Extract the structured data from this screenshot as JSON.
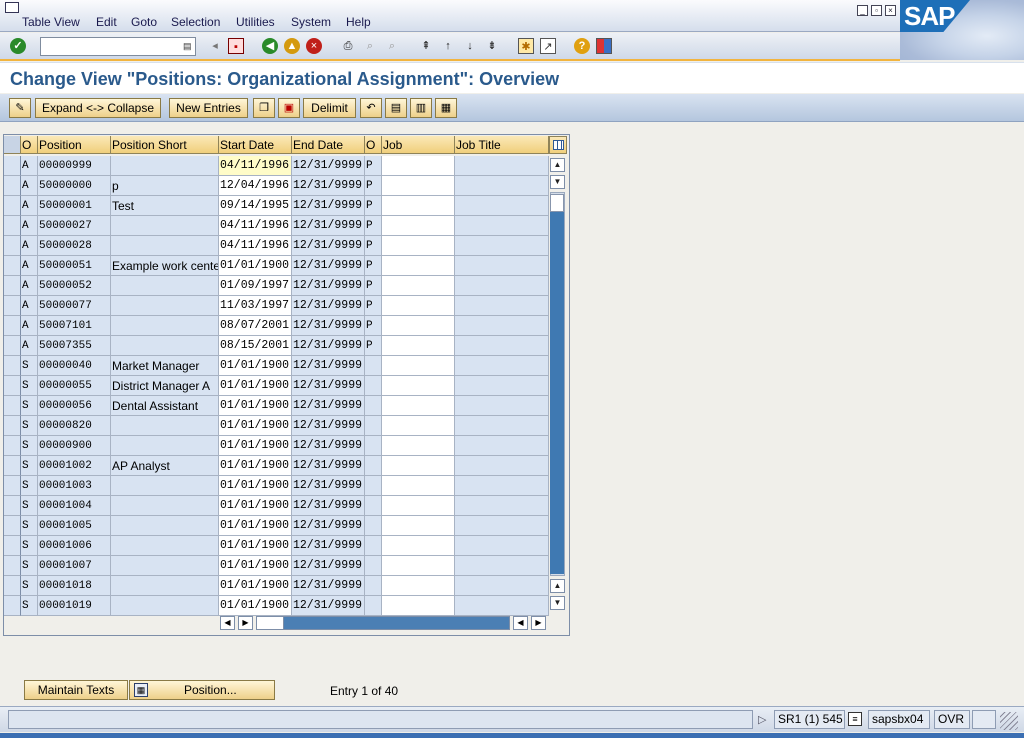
{
  "menubar": {
    "items": [
      "Table View",
      "Edit",
      "Goto",
      "Selection",
      "Utilities",
      "System",
      "Help"
    ],
    "logo": "SAP"
  },
  "toolbar": {
    "command_value": "",
    "icons": [
      "enter-icon",
      "save-icon",
      "back-icon",
      "exit-icon",
      "cancel-icon",
      "print-icon",
      "find-icon",
      "find-next-icon",
      "first-page-icon",
      "previous-page-icon",
      "next-page-icon",
      "last-page-icon",
      "create-session-icon",
      "shortcut-icon",
      "help-icon",
      "customize-layout-icon"
    ]
  },
  "title": "Change View \"Positions: Organizational Assignment\": Overview",
  "app_toolbar": {
    "expand_collapse": "Expand <-> Collapse",
    "new_entries": "New Entries",
    "delimit": "Delimit"
  },
  "table": {
    "headers": [
      "O",
      "Position",
      "Position Short",
      "Start Date",
      "End Date",
      "O",
      "Job",
      "Job Title"
    ],
    "rows": [
      [
        "A",
        "00000999",
        "",
        "04/11/1996",
        "12/31/9999",
        "P",
        "",
        ""
      ],
      [
        "A",
        "50000000",
        "p",
        "12/04/1996",
        "12/31/9999",
        "P",
        "",
        ""
      ],
      [
        "A",
        "50000001",
        "Test",
        "09/14/1995",
        "12/31/9999",
        "P",
        "",
        ""
      ],
      [
        "A",
        "50000027",
        "",
        "04/11/1996",
        "12/31/9999",
        "P",
        "",
        ""
      ],
      [
        "A",
        "50000028",
        "",
        "04/11/1996",
        "12/31/9999",
        "P",
        "",
        ""
      ],
      [
        "A",
        "50000051",
        "Example work cente",
        "01/01/1900",
        "12/31/9999",
        "P",
        "",
        ""
      ],
      [
        "A",
        "50000052",
        "",
        "01/09/1997",
        "12/31/9999",
        "P",
        "",
        ""
      ],
      [
        "A",
        "50000077",
        "",
        "11/03/1997",
        "12/31/9999",
        "P",
        "",
        ""
      ],
      [
        "A",
        "50007101",
        "",
        "08/07/2001",
        "12/31/9999",
        "P",
        "",
        ""
      ],
      [
        "A",
        "50007355",
        "",
        "08/15/2001",
        "12/31/9999",
        "P",
        "",
        ""
      ],
      [
        "S",
        "00000040",
        "Market Manager",
        "01/01/1900",
        "12/31/9999",
        "",
        "",
        ""
      ],
      [
        "S",
        "00000055",
        "District Manager A",
        "01/01/1900",
        "12/31/9999",
        "",
        "",
        ""
      ],
      [
        "S",
        "00000056",
        "Dental Assistant",
        "01/01/1900",
        "12/31/9999",
        "",
        "",
        ""
      ],
      [
        "S",
        "00000820",
        "",
        "01/01/1900",
        "12/31/9999",
        "",
        "",
        ""
      ],
      [
        "S",
        "00000900",
        "",
        "01/01/1900",
        "12/31/9999",
        "",
        "",
        ""
      ],
      [
        "S",
        "00001002",
        "AP Analyst",
        "01/01/1900",
        "12/31/9999",
        "",
        "",
        ""
      ],
      [
        "S",
        "00001003",
        "",
        "01/01/1900",
        "12/31/9999",
        "",
        "",
        ""
      ],
      [
        "S",
        "00001004",
        "",
        "01/01/1900",
        "12/31/9999",
        "",
        "",
        ""
      ],
      [
        "S",
        "00001005",
        "",
        "01/01/1900",
        "12/31/9999",
        "",
        "",
        ""
      ],
      [
        "S",
        "00001006",
        "",
        "01/01/1900",
        "12/31/9999",
        "",
        "",
        ""
      ],
      [
        "S",
        "00001007",
        "",
        "01/01/1900",
        "12/31/9999",
        "",
        "",
        ""
      ],
      [
        "S",
        "00001018",
        "",
        "01/01/1900",
        "12/31/9999",
        "",
        "",
        ""
      ],
      [
        "S",
        "00001019",
        "",
        "01/01/1900",
        "12/31/9999",
        "",
        "",
        ""
      ]
    ]
  },
  "footer": {
    "maintain_texts": "Maintain Texts",
    "position_button": "Position...",
    "entry_info": "Entry 1 of 40"
  },
  "status": {
    "system": "SR1 (1) 545",
    "server": "sapsbx04",
    "mode": "OVR"
  }
}
